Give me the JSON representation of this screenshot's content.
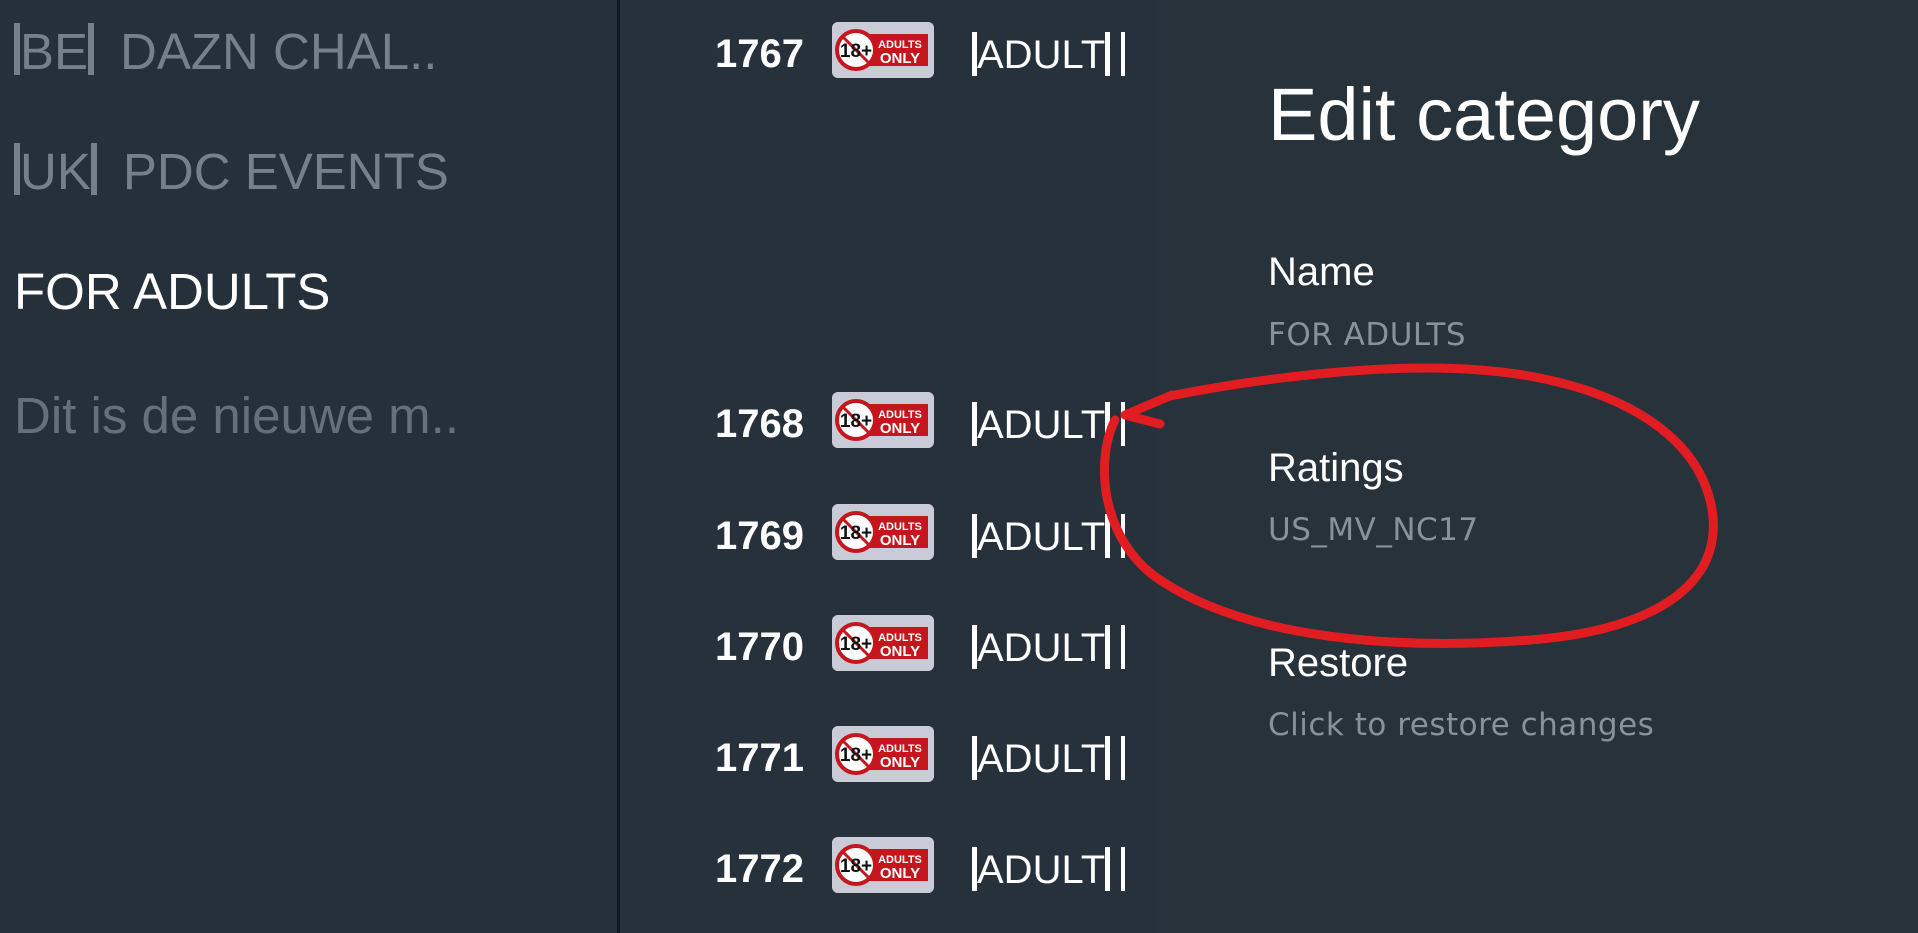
{
  "categories": [
    {
      "tag": "BE",
      "name": "DAZN CHAL.."
    },
    {
      "tag": "UK",
      "name": "PDC EVENTS"
    }
  ],
  "selected_category": {
    "name": "FOR ADULTS",
    "description": "Dit is de nieuwe m.."
  },
  "channels": [
    {
      "number": "1767",
      "name": "ADULT",
      "logo_text_top": "ADULTS",
      "logo_text_bottom": "ONLY",
      "logo_badge": "18+"
    },
    {
      "number": "1768",
      "name": "ADULT",
      "logo_text_top": "ADULTS",
      "logo_text_bottom": "ONLY",
      "logo_badge": "18+"
    },
    {
      "number": "1769",
      "name": "ADULT",
      "logo_text_top": "ADULTS",
      "logo_text_bottom": "ONLY",
      "logo_badge": "18+"
    },
    {
      "number": "1770",
      "name": "ADULT",
      "logo_text_top": "ADULTS",
      "logo_text_bottom": "ONLY",
      "logo_badge": "18+"
    },
    {
      "number": "1771",
      "name": "ADULT",
      "logo_text_top": "ADULTS",
      "logo_text_bottom": "ONLY",
      "logo_badge": "18+"
    },
    {
      "number": "1772",
      "name": "ADULT",
      "logo_text_top": "ADULTS",
      "logo_text_bottom": "ONLY",
      "logo_badge": "18+"
    }
  ],
  "dialog": {
    "title": "Edit category",
    "fields": [
      {
        "label": "Name",
        "value": "FOR ADULTS"
      },
      {
        "label": "Ratings",
        "value": "US_MV_NC17"
      },
      {
        "label": "Restore",
        "value": "Click to restore changes"
      }
    ]
  },
  "colors": {
    "background": "#26303a",
    "annotation": "#e11d22",
    "logo_red": "#c4161c",
    "text_dim": "#76808a"
  },
  "icons": {
    "channel_logo": "adults-only-logo",
    "annotation": "hand-drawn-circle-arrow"
  }
}
